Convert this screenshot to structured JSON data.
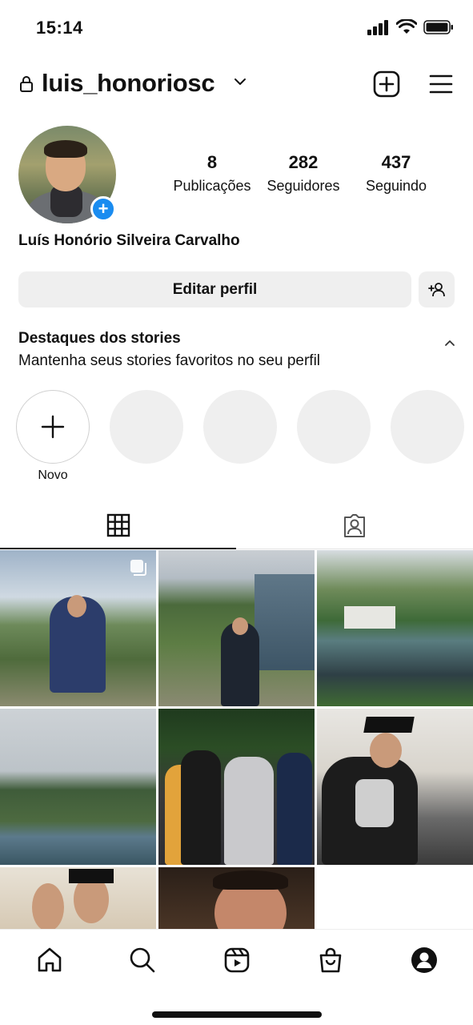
{
  "status_bar": {
    "time": "15:14"
  },
  "header": {
    "username": "luis_honoriosc"
  },
  "profile": {
    "full_name": "Luís Honório Silveira Carvalho",
    "stats": [
      {
        "value": "8",
        "label": "Publicações"
      },
      {
        "value": "282",
        "label": "Seguidores"
      },
      {
        "value": "437",
        "label": "Seguindo"
      }
    ],
    "edit_label": "Editar perfil"
  },
  "highlights": {
    "title": "Destaques dos stories",
    "subtitle": "Mantenha seus stories favoritos no seu perfil",
    "new_label": "Novo"
  },
  "colors": {
    "accent": "#1a8cf0",
    "button_bg": "#efefef"
  },
  "bottom_nav": [
    "home-icon",
    "search-icon",
    "reels-icon",
    "shop-icon",
    "profile-icon"
  ]
}
